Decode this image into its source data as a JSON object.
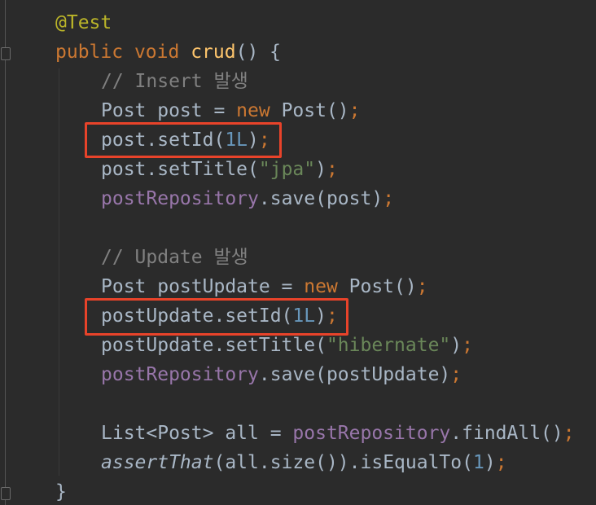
{
  "code": {
    "l1": {
      "annotation": "@Test"
    },
    "l2": {
      "kw1": "public",
      "kw2": "void",
      "name": "crud",
      "rest": "() {"
    },
    "l3": {
      "comment": "// Insert 발생"
    },
    "l4": {
      "a": "Post post = ",
      "kw": "new",
      "b": " Post()",
      "semi": ";"
    },
    "l5": {
      "a": "post.setId(",
      "num": "1L",
      "b": ")",
      "semi": ";"
    },
    "l6": {
      "a": "post.setTitle(",
      "str": "\"jpa\"",
      "b": ")",
      "semi": ";"
    },
    "l7": {
      "field": "postRepository",
      "a": ".save(post)",
      "semi": ";"
    },
    "l9": {
      "comment": "// Update 발생"
    },
    "l10": {
      "a": "Post postUpdate = ",
      "kw": "new",
      "b": " Post()",
      "semi": ";"
    },
    "l11": {
      "a": "postUpdate.setId(",
      "num": "1L",
      "b": ")",
      "semi": ";"
    },
    "l12": {
      "a": "postUpdate.setTitle(",
      "str": "\"hibernate\"",
      "b": ")",
      "semi": ";"
    },
    "l13": {
      "field": "postRepository",
      "a": ".save(postUpdate)",
      "semi": ";"
    },
    "l15": {
      "a": "List<Post> all = ",
      "field": "postRepository",
      "b": ".findAll()",
      "semi": ";"
    },
    "l16": {
      "method": "assertThat",
      "a": "(all.size()).isEqualTo(",
      "num": "1",
      "b": ")",
      "semi": ";"
    },
    "l17": {
      "brace": "}"
    }
  },
  "colors": {
    "background": "#2b2b2b",
    "default_text": "#a9b7c6",
    "keyword": "#cc7832",
    "annotation": "#bbb529",
    "method_declaration": "#ffc66d",
    "field": "#9876aa",
    "number": "#6897bb",
    "string": "#6a8759",
    "comment": "#808080",
    "highlight_box": "#e8432a"
  }
}
